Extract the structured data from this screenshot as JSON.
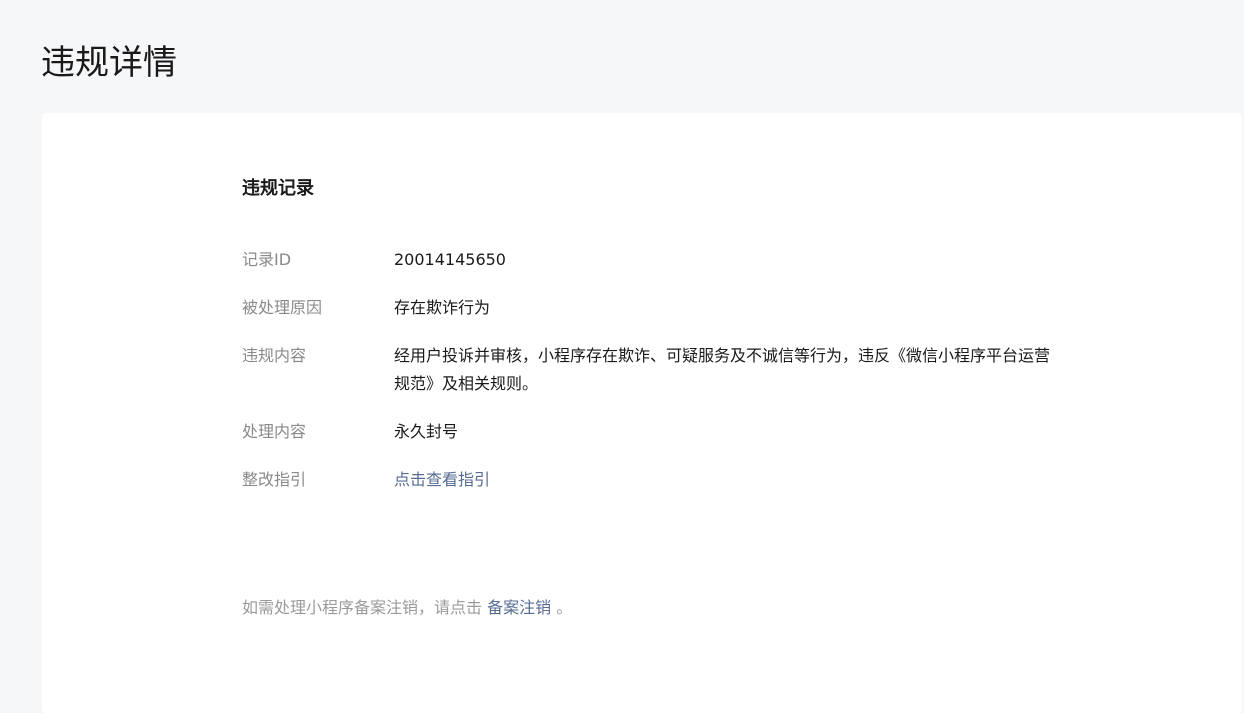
{
  "page": {
    "title": "违规详情"
  },
  "record": {
    "section_title": "违规记录",
    "rows": [
      {
        "label": "记录ID",
        "value": "20014145650"
      },
      {
        "label": "被处理原因",
        "value": "存在欺诈行为"
      },
      {
        "label": "违规内容",
        "value": "经用户投诉并审核，小程序存在欺诈、可疑服务及不诚信等行为，违反《微信小程序平台运营规范》及相关规则。"
      },
      {
        "label": "处理内容",
        "value": "永久封号"
      },
      {
        "label": "整改指引",
        "value": "点击查看指引"
      }
    ]
  },
  "footer": {
    "prefix": "如需处理小程序备案注销，请点击",
    "link": "备案注销",
    "suffix": "。"
  },
  "colors": {
    "background": "#f6f7f9",
    "card": "#ffffff",
    "link": "#576b95",
    "label": "#8a8a8a",
    "text": "#1a1a1a"
  }
}
